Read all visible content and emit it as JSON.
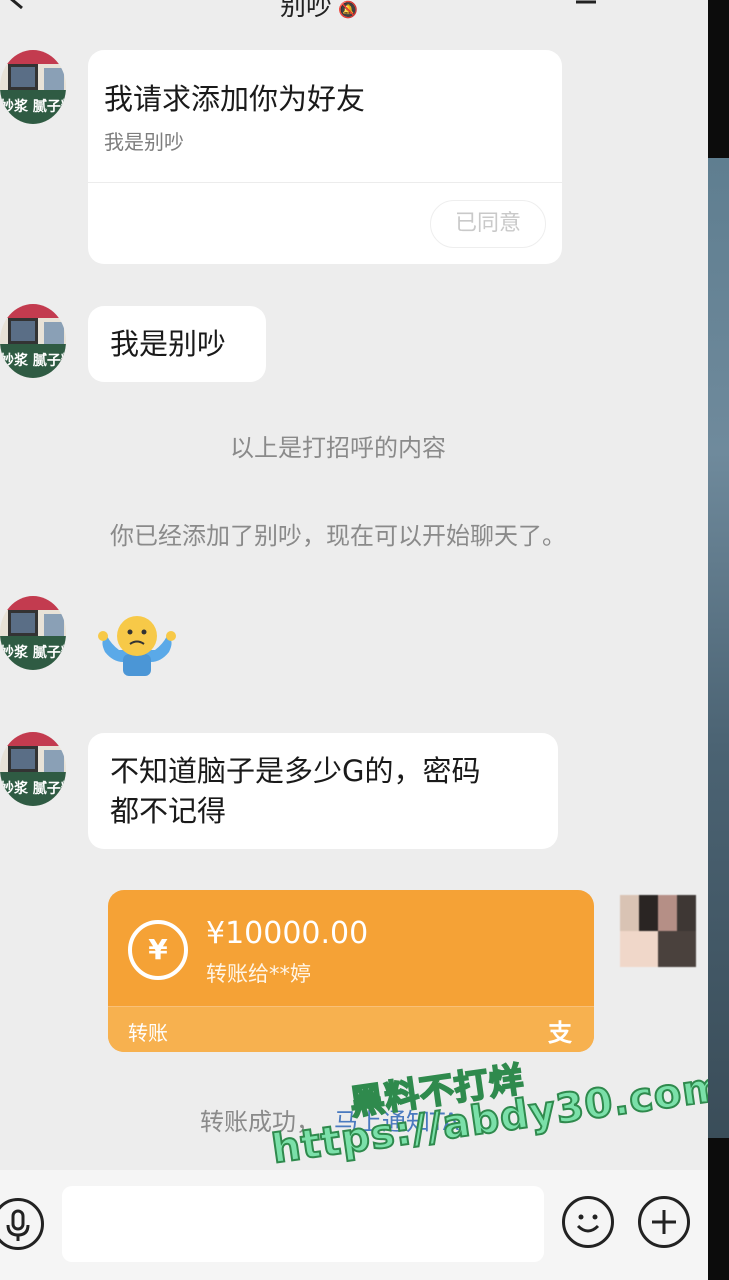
{
  "header": {
    "title": "别吵",
    "mute_icon": "bell-off-icon",
    "back_icon": "chevron-left-icon",
    "menu_icon": "chat-list-icon"
  },
  "contact": {
    "avatar_sign": "妙浆 腻子粉"
  },
  "friend_request": {
    "title": "我请求添加你为好友",
    "subtitle": "我是别吵",
    "status_button": "已同意"
  },
  "messages": [
    {
      "type": "text",
      "text": "我是别吵"
    },
    {
      "type": "emoji",
      "icon": "shrug-emoji-icon"
    },
    {
      "type": "text",
      "text": "不知道脑子是多少G的，密码都不记得",
      "line1": "不知道脑子是多少G的，密码",
      "line2": "都不记得"
    }
  ],
  "system": {
    "greeting_note": "以上是打招呼的内容",
    "added_note": "你已经添加了别吵，现在可以开始聊天了。"
  },
  "transfer": {
    "amount": "¥10000.00",
    "recipient": "转账给**婷",
    "label": "转账",
    "brand_glyph": "支",
    "icon": "yen-transfer-icon",
    "color": "#f5a236"
  },
  "status": {
    "success_text": "转账成功，",
    "link_text": "马上通知TA"
  },
  "watermark": {
    "title": "黑料不打烊",
    "url": "https://abdy30.com"
  },
  "input": {
    "placeholder": "",
    "voice_icon": "microphone-icon",
    "emoji_icon": "smiley-icon",
    "plus_icon": "plus-icon"
  }
}
